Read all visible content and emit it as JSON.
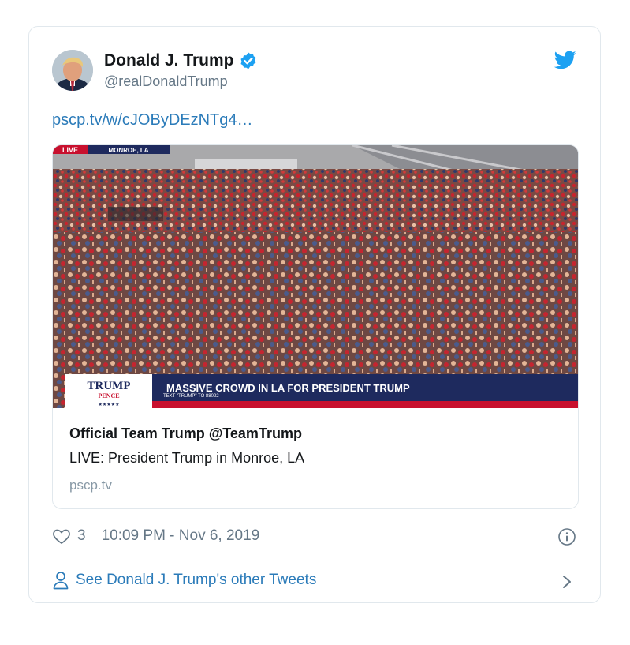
{
  "tweet": {
    "author_name": "Donald J. Trump",
    "author_handle": "@realDonaldTrump",
    "link_text": "pscp.tv/w/cJOByDEzNTg4…",
    "card": {
      "overlay_live": "LIVE",
      "overlay_location": "MONROE, LA",
      "overlay_logo_top": "TRUMP",
      "overlay_logo_bottom": "PENCE",
      "overlay_headline": "MASSIVE CROWD IN LA FOR PRESIDENT TRUMP",
      "overlay_ticker": "TEXT \"TRUMP\" TO 88022",
      "title": "Official Team Trump @TeamTrump",
      "description": "LIVE: President Trump in Monroe, LA",
      "domain": "pscp.tv"
    },
    "like_count": "3",
    "timestamp": "10:09 PM - Nov 6, 2019",
    "footer_link": "See Donald J. Trump's other Tweets"
  },
  "colors": {
    "link_blue": "#2b7bb9",
    "twitter_blue": "#1da1f2",
    "secondary_text": "#657786",
    "border": "#e1e8ed",
    "banner_navy": "#1e2a5e",
    "banner_red": "#c8102e"
  },
  "icons": [
    "verified-badge-icon",
    "twitter-bird-icon",
    "heart-icon",
    "info-icon",
    "person-icon",
    "chevron-right-icon"
  ]
}
